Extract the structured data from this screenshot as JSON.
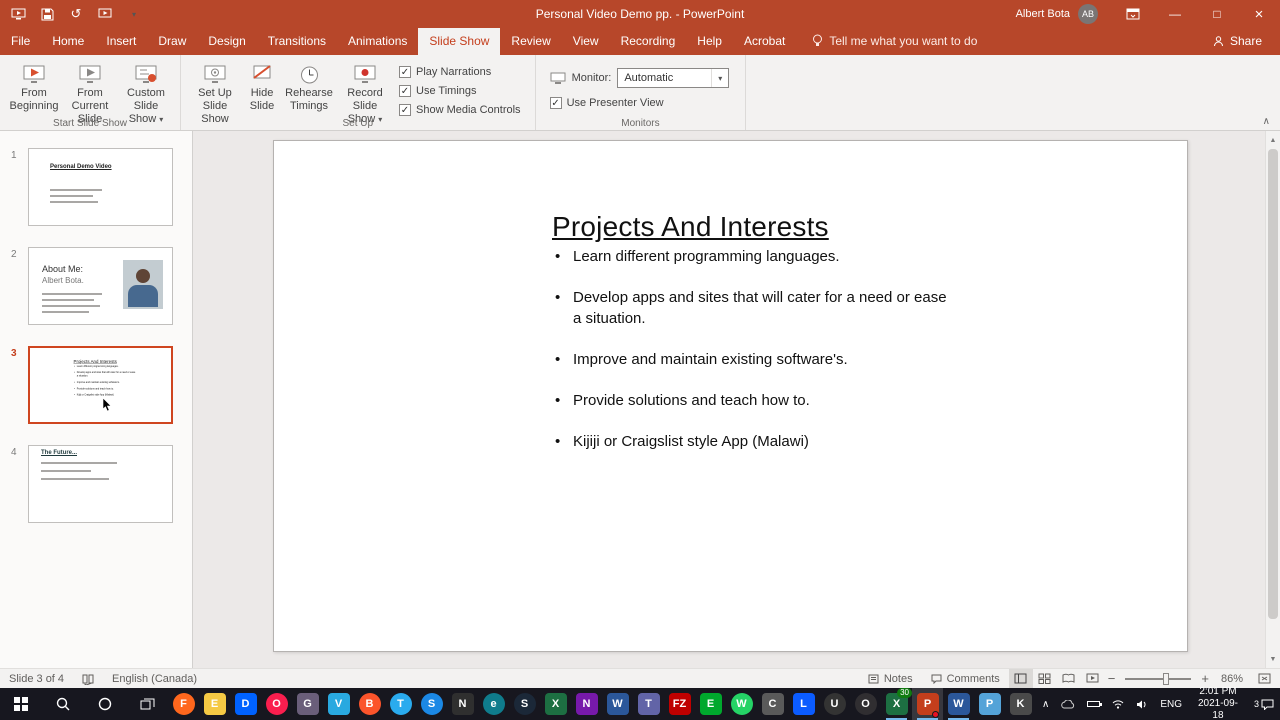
{
  "colors": {
    "titlebar": "#b7472a",
    "active_tab_text": "#c43e1c",
    "ribbon_bg": "#f3f2f1",
    "selected_thumb_border": "#cf4520",
    "taskbar_bg": "#17171f",
    "open_app_indicator": "#76b9ed"
  },
  "titlebar": {
    "title": "Personal Video Demo pp. - PowerPoint",
    "user": "Albert Bota",
    "avatar_initials": "AB",
    "quick_access_icons": [
      "slideshow-icon",
      "save-icon",
      "undo-icon",
      "customize-quick-access-icon"
    ],
    "window_icons": [
      "ribbon-display-options-icon",
      "minimize-icon",
      "maximize-icon",
      "close-icon"
    ]
  },
  "ribbon": {
    "tabs": [
      "File",
      "Home",
      "Insert",
      "Draw",
      "Design",
      "Transitions",
      "Animations",
      "Slide Show",
      "Review",
      "View",
      "Recording",
      "Help",
      "Acrobat"
    ],
    "active_tab": "Slide Show",
    "tell_me": "Tell me what you want to do",
    "share": "Share",
    "start_group": {
      "label": "Start Slide Show",
      "from_beginning": "From Beginning",
      "from_current": "From Current Slide",
      "custom": "Custom Slide Show"
    },
    "setup_group": {
      "label": "Set Up",
      "setup_show": "Set Up Slide Show",
      "hide_slide": "Hide Slide",
      "rehearse": "Rehearse Timings",
      "record": "Record Slide Show",
      "checkboxes": [
        {
          "label": "Play Narrations",
          "checked": true
        },
        {
          "label": "Use Timings",
          "checked": true
        },
        {
          "label": "Show Media Controls",
          "checked": true
        }
      ]
    },
    "monitors_group": {
      "label": "Monitors",
      "monitor_label": "Monitor:",
      "monitor_value": "Automatic",
      "presenter_checkbox": {
        "label": "Use Presenter View",
        "checked": true
      }
    }
  },
  "thumbnails": {
    "panel": [
      {
        "number": "1",
        "title": "Personal Demo Video"
      },
      {
        "number": "2",
        "title": "About Me:",
        "subtitle": "Albert Bota."
      },
      {
        "number": "3",
        "selected": true
      },
      {
        "number": "4",
        "title": "The Future..."
      }
    ]
  },
  "slide": {
    "title": "Projects And Interests",
    "bullets": [
      "Learn different programming languages.",
      "Develop apps and sites that will cater for a need or ease a situation.",
      "Improve and maintain existing software's.",
      "Provide solutions and teach how to.",
      "Kijiji or Craigslist style App (Malawi)"
    ]
  },
  "statusbar": {
    "slide_indicator": "Slide 3 of 4",
    "language": "English (Canada)",
    "notes": "Notes",
    "comments": "Comments",
    "zoom_percent": "86%",
    "view_icons": [
      "normal-view-icon",
      "slide-sorter-icon",
      "reading-view-icon",
      "slideshow-view-icon"
    ]
  },
  "taskbar": {
    "lang": "ENG",
    "time": "2:01 PM",
    "date": "2021-09-18",
    "notification_count": "3",
    "tray_icons": [
      "hidden-icons-chevron",
      "onedrive-icon",
      "battery-icon",
      "network-icon",
      "volume-icon"
    ],
    "apps": [
      {
        "name": "firefox",
        "glyph": "F",
        "color": "#ff671d",
        "shape": "circle"
      },
      {
        "name": "file-explorer",
        "glyph": "E",
        "color": "#f5c944"
      },
      {
        "name": "dropbox",
        "glyph": "D",
        "color": "#0062ff"
      },
      {
        "name": "opera",
        "glyph": "O",
        "color": "#fa1e4e",
        "shape": "circle"
      },
      {
        "name": "gimp",
        "glyph": "G",
        "color": "#6a5e7a"
      },
      {
        "name": "vscode",
        "glyph": "V",
        "color": "#29a9e0"
      },
      {
        "name": "brave",
        "glyph": "B",
        "color": "#fb542b",
        "shape": "circle"
      },
      {
        "name": "telegram",
        "glyph": "T",
        "color": "#2aabee",
        "shape": "circle"
      },
      {
        "name": "safari",
        "glyph": "S",
        "color": "#1b88e5",
        "shape": "circle"
      },
      {
        "name": "notion",
        "glyph": "N",
        "color": "#2f2f2f"
      },
      {
        "name": "edge",
        "glyph": "e",
        "color": "#0f7c8c",
        "shape": "circle"
      },
      {
        "name": "steam",
        "glyph": "S",
        "color": "#1b2838",
        "shape": "circle"
      },
      {
        "name": "excel",
        "glyph": "X",
        "color": "#1d6f42"
      },
      {
        "name": "onenote",
        "glyph": "N",
        "color": "#7719aa"
      },
      {
        "name": "word",
        "glyph": "W",
        "color": "#2b579a"
      },
      {
        "name": "teams",
        "glyph": "T",
        "color": "#6264a7"
      },
      {
        "name": "filezilla",
        "glyph": "FZ",
        "color": "#bf0000"
      },
      {
        "name": "evernote",
        "glyph": "E",
        "color": "#00a82d"
      },
      {
        "name": "whatsapp",
        "glyph": "W",
        "color": "#25d366",
        "shape": "circle"
      },
      {
        "name": "camera",
        "glyph": "C",
        "color": "#5a5a5a"
      },
      {
        "name": "live",
        "glyph": "L",
        "color": "#0b5cff"
      },
      {
        "name": "ubuntu",
        "glyph": "U",
        "color": "#333333",
        "shape": "circle"
      },
      {
        "name": "obs",
        "glyph": "O",
        "color": "#302e31",
        "shape": "circle"
      },
      {
        "name": "excel-open",
        "glyph": "X",
        "color": "#1d6f42",
        "badge": "30",
        "open": true
      },
      {
        "name": "powerpoint",
        "glyph": "P",
        "color": "#c43e1c",
        "open": true,
        "active": true,
        "dot": true
      },
      {
        "name": "word-open",
        "glyph": "W",
        "color": "#2b579a",
        "open": true
      },
      {
        "name": "photos",
        "glyph": "P",
        "color": "#54a3d8"
      },
      {
        "name": "keyboard",
        "glyph": "K",
        "color": "#4a4a4a"
      }
    ]
  }
}
